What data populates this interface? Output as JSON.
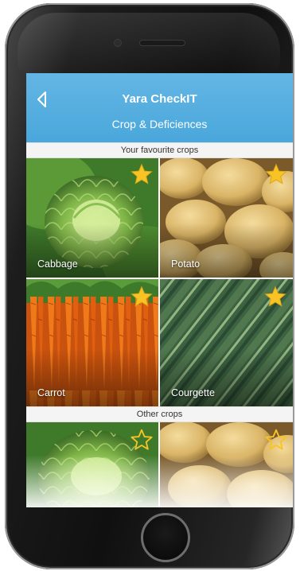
{
  "header": {
    "title": "Yara CheckIT",
    "subtitle": "Crop & Deficiences",
    "back_icon": "chevron-left-icon"
  },
  "favourites": {
    "label": "Your favourite crops",
    "crops": [
      {
        "name": "Cabbage",
        "favourite": true
      },
      {
        "name": "Potato",
        "favourite": true
      },
      {
        "name": "Carrot",
        "favourite": true
      },
      {
        "name": "Courgette",
        "favourite": true
      }
    ]
  },
  "others": {
    "label": "Other crops",
    "crops": [
      {
        "favourite": false
      },
      {
        "favourite": false
      }
    ]
  },
  "colors": {
    "header_blue": "#4aa7db",
    "star_gold": "#f7c325"
  }
}
